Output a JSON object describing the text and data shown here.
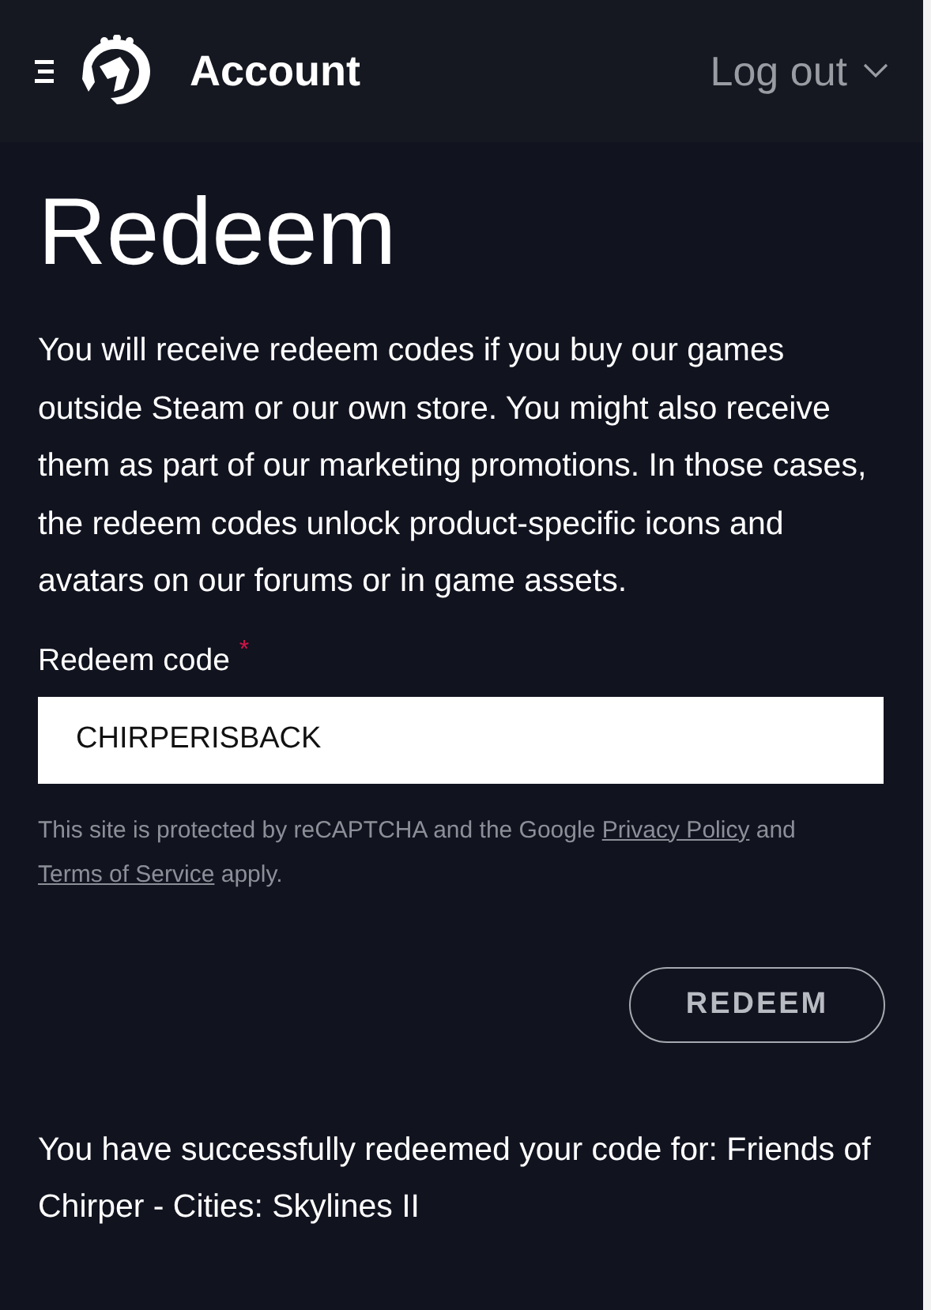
{
  "header": {
    "title": "Account",
    "logout": "Log out"
  },
  "page": {
    "title": "Redeem",
    "intro": "You will receive redeem codes if you buy our games outside Steam or our own store. You might also receive them as part of our marketing promotions. In those cases, the redeem codes unlock product-specific icons and avatars on our forums or in game assets."
  },
  "form": {
    "label": "Redeem code",
    "required_mark": "*",
    "value": "CHIRPERISBACK",
    "notice": {
      "before": "This site is protected by reCAPTCHA and the Google ",
      "link_1": "Privacy Policy",
      "middle": " and ",
      "link_2": "Terms of Service",
      "after": " apply."
    },
    "button": "REDEEM"
  },
  "result": "You have successfully redeemed your code for: Friends of Chirper - Cities: Skylines II"
}
